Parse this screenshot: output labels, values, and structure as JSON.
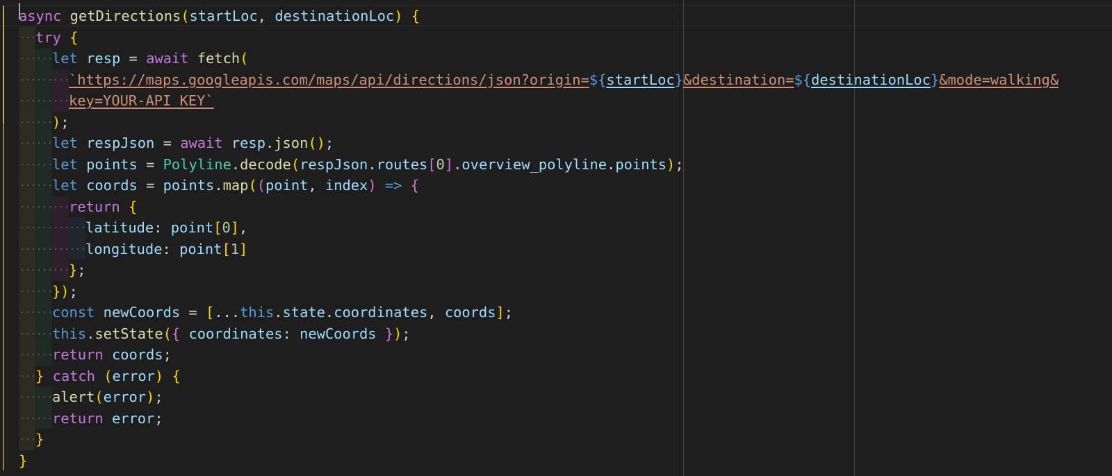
{
  "editor": {
    "language": "javascript",
    "colors": {
      "background": "#1e1e1e",
      "keyword": "#569cd6",
      "control_keyword": "#c678dd",
      "function": "#dcdcaa",
      "variable": "#9cdcfe",
      "string": "#ce9178",
      "number": "#b5cea8",
      "bracket_level1": "#ffd700",
      "bracket_level2": "#da70d6",
      "bracket_level3": "#179fff"
    },
    "lines": [
      "async getDirections(startLoc, destinationLoc) {",
      "try {",
      "let resp = await fetch(",
      "`https://maps.googleapis.com/maps/api/directions/json?origin=${startLoc}&destination=${destinationLoc}&mode=walking&",
      "key=YOUR-API_KEY`",
      ");",
      "let respJson = await resp.json();",
      "let points = Polyline.decode(respJson.routes[0].overview_polyline.points);",
      "let coords = points.map((point, index) => {",
      "return {",
      "latitude: point[0],",
      "longitude: point[1]",
      "};",
      "});",
      "const newCoords = [...this.state.coordinates, coords];",
      "this.setState({ coordinates: newCoords });",
      "return coords;",
      "} catch (error) {",
      "alert(error);",
      "return error;",
      "}",
      "}"
    ]
  }
}
